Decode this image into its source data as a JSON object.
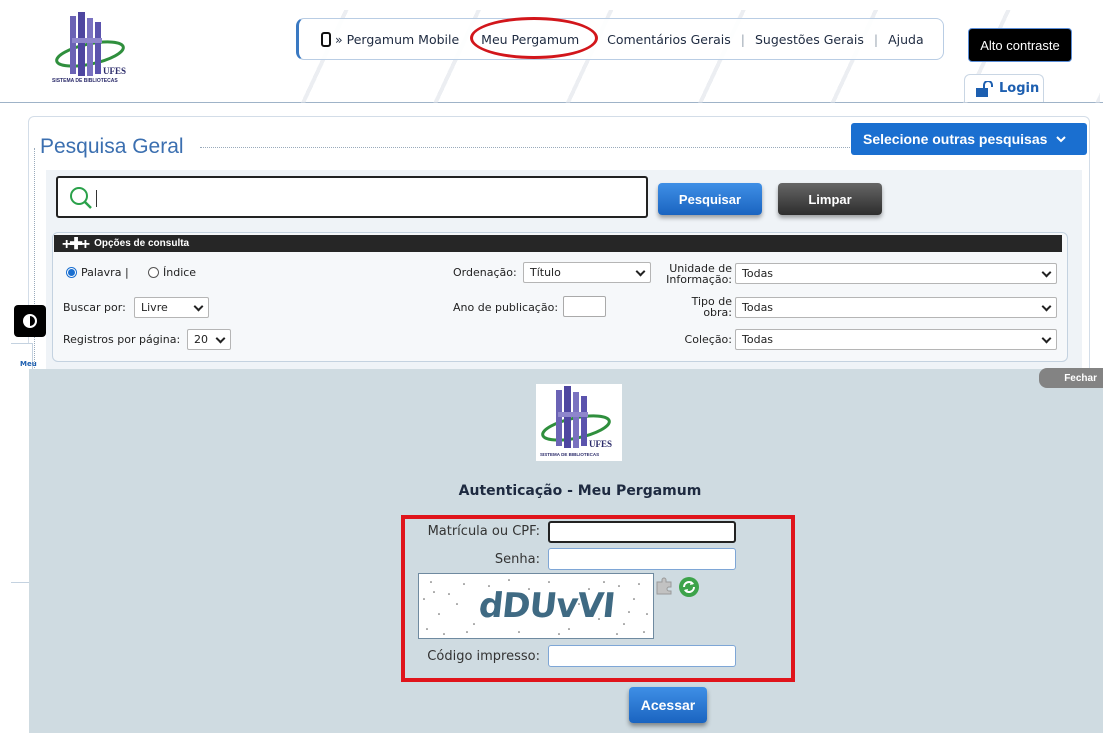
{
  "header": {
    "logo_alt": "Sistema de Bibliotecas UFES",
    "logo_ufes": "UFES",
    "logo_caption": "SISTEMA DE BIBLIOTECAS",
    "nav": {
      "mobile": "» Pergamum Mobile",
      "meu": "Meu Pergamum",
      "comentarios": "Comentários Gerais",
      "sugestoes": "Sugestões Gerais",
      "ajuda": "Ajuda",
      "separator": "|"
    },
    "alto_contraste": "Alto contraste",
    "login": "Login"
  },
  "search": {
    "title": "Pesquisa Geral",
    "outras": "Selecione outras pesquisas",
    "pesquisar": "Pesquisar",
    "limpar": "Limpar",
    "opcoes_title": "Opções de consulta",
    "palavra": "Palavra |",
    "indice": "Índice",
    "buscar_por_label": "Buscar por:",
    "buscar_por_value": "Livre",
    "registros_label": "Registros por página:",
    "registros_value": "20",
    "ordenacao_label": "Ordenação:",
    "ordenacao_value": "Título",
    "ano_label": "Ano de publicação:",
    "unidade_label_1": "Unidade de",
    "unidade_label_2": "Informação:",
    "unidade_value": "Todas",
    "tipo_label_1": "Tipo de",
    "tipo_label_2": "obra:",
    "tipo_value": "Todas",
    "colecao_label": "Coleção:",
    "colecao_value": "Todas"
  },
  "side": {
    "tab_label": "Meu"
  },
  "overlay": {
    "fechar": "Fechar",
    "logo_ufes": "UFES",
    "logo_caption": "SISTEMA DE BIBLIOTECAS",
    "title": "Autenticação - Meu Pergamum",
    "matricula_label": "Matrícula ou CPF:",
    "senha_label": "Senha:",
    "captcha_text": "dDUvVI",
    "codigo_label": "Código impresso:",
    "acessar": "Acessar"
  }
}
